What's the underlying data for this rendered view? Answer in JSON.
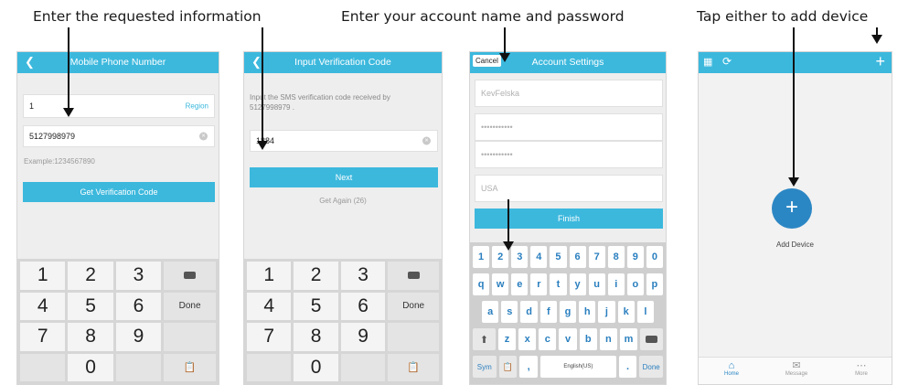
{
  "captions": {
    "step1": "Enter the requested information",
    "step2": "Enter your account name and password",
    "step3": "Tap either to add device"
  },
  "screen1": {
    "title": "Mobile Phone Number",
    "country_code": "1",
    "region_label": "Region",
    "phone_value": "5127998979",
    "example": "Example:1234567890",
    "button": "Get Verification Code"
  },
  "screen2": {
    "title": "Input Verification Code",
    "info_line1": "Input the SMS verification code received by",
    "info_line2": "5127998979 .",
    "code_value": "1884",
    "next_button": "Next",
    "get_again": "Get Again (26)"
  },
  "screen3": {
    "cancel": "Cancel",
    "title": "Account Settings",
    "username": "KevFelska",
    "password1": "•••••••••••",
    "password2": "•••••••••••",
    "country": "USA",
    "finish_button": "Finish"
  },
  "screen4": {
    "add_device": "Add Device",
    "plus": "+",
    "tabs": [
      "Home",
      "Message",
      "More"
    ]
  },
  "numpad_keys": [
    "1",
    "2",
    "3",
    "",
    "4",
    "5",
    "6",
    "Done",
    "7",
    "8",
    "9",
    "",
    "",
    "0",
    "",
    ""
  ],
  "keyboard": {
    "row_numbers": [
      "1",
      "2",
      "3",
      "4",
      "5",
      "6",
      "7",
      "8",
      "9",
      "0"
    ],
    "row1": [
      "q",
      "w",
      "e",
      "r",
      "t",
      "y",
      "u",
      "i",
      "o",
      "p"
    ],
    "row2": [
      "a",
      "s",
      "d",
      "f",
      "g",
      "h",
      "j",
      "k",
      "l"
    ],
    "row3": [
      "z",
      "x",
      "c",
      "v",
      "b",
      "n",
      "m"
    ],
    "sym": "Sym",
    "comma": ",",
    "space": "English(US)",
    "period": ".",
    "done": "Done"
  },
  "colors": {
    "header": "#3cb8dd",
    "add_button": "#2b87c4"
  }
}
